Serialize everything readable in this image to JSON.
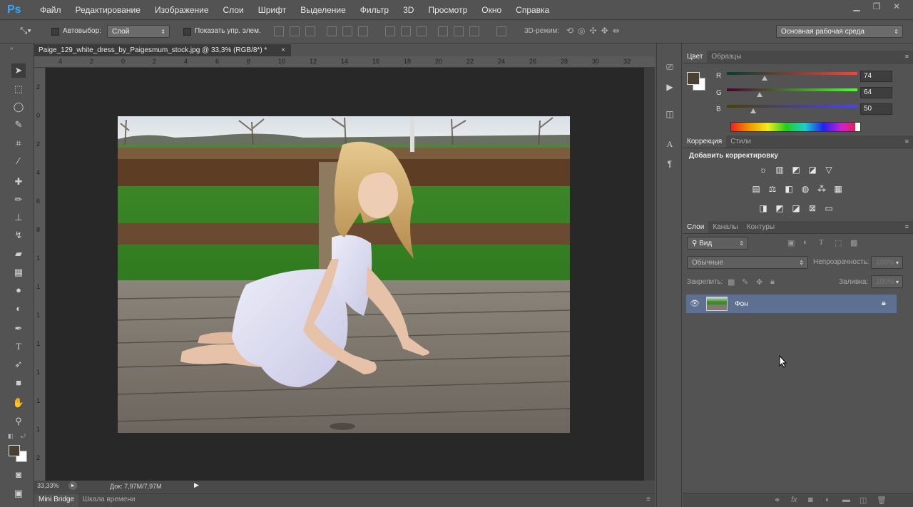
{
  "app": {
    "logo": "Ps"
  },
  "menu": [
    "Файл",
    "Редактирование",
    "Изображение",
    "Слои",
    "Шрифт",
    "Выделение",
    "Фильтр",
    "3D",
    "Просмотр",
    "Окно",
    "Справка"
  ],
  "options": {
    "auto_select_label": "Автовыбор:",
    "auto_select_value": "Слой",
    "show_controls_label": "Показать упр. элем.",
    "mode_3d": "3D-режим:",
    "workspace": "Основная рабочая среда"
  },
  "document": {
    "tab_title": "Paige_129_white_dress_by_Paigesmum_stock.jpg @ 33,3% (RGB/8*) *",
    "zoom": "33,33%",
    "doc_size": "Док: 7,97M/7,97M",
    "ruler_top": [
      "4",
      "2",
      "0",
      "2",
      "4",
      "6",
      "8",
      "10",
      "12",
      "14",
      "16",
      "18",
      "20",
      "22",
      "24",
      "26",
      "28",
      "30",
      "32"
    ],
    "ruler_left": [
      "2",
      "0",
      "2",
      "4",
      "6",
      "8",
      "1",
      "1",
      "1",
      "1",
      "1",
      "1",
      "1",
      "2",
      "2"
    ]
  },
  "bottom_tabs": [
    "Mini Bridge",
    "Шкала времени"
  ],
  "color_panel": {
    "tabs": [
      "Цвет",
      "Образцы"
    ],
    "r_label": "R",
    "g_label": "G",
    "b_label": "B",
    "r": "74",
    "g": "64",
    "b": "50",
    "r_level": 0.29,
    "g_level": 0.25,
    "b_level": 0.2,
    "foreground": "#4a4032",
    "background": "#ffffff"
  },
  "adjust_panel": {
    "tabs": [
      "Коррекция",
      "Стили"
    ],
    "heading": "Добавить корректировку"
  },
  "layers_panel": {
    "tabs": [
      "Слои",
      "Каналы",
      "Контуры"
    ],
    "filter": "Вид",
    "blend_mode": "Обычные",
    "opacity_label": "Непрозрачность:",
    "opacity_value": "100%",
    "lock_label": "Закрепить:",
    "fill_label": "Заливка:",
    "fill_value": "100%",
    "layers": [
      {
        "name": "Фон"
      }
    ]
  }
}
